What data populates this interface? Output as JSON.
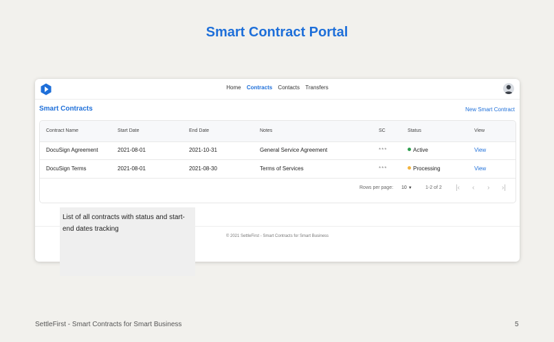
{
  "slide": {
    "title": "Smart Contract Portal",
    "footer_left": "SettleFirst - Smart Contracts for Smart Business",
    "page_number": "5"
  },
  "nav": {
    "items": [
      {
        "label": "Home",
        "active": false
      },
      {
        "label": "Contracts",
        "active": true
      },
      {
        "label": "Contacts",
        "active": false
      },
      {
        "label": "Transfers",
        "active": false
      }
    ]
  },
  "section": {
    "title": "Smart Contracts",
    "new_link": "New Smart Contract"
  },
  "table": {
    "headers": [
      "Contract Name",
      "Start Date",
      "End Date",
      "Notes",
      "SC",
      "Status",
      "View"
    ],
    "rows": [
      {
        "name": "DocuSign Agreement",
        "start": "2021-08-01",
        "end": "2021-10-31",
        "notes": "General Service Agreement",
        "sc": "***",
        "status": "Active",
        "status_color": "#2e9e4f",
        "view": "View"
      },
      {
        "name": "DocuSign Terms",
        "start": "2021-08-01",
        "end": "2021-08-30",
        "notes": "Terms of Services",
        "sc": "***",
        "status": "Processing",
        "status_color": "#f2b33d",
        "view": "View"
      }
    ],
    "pagination": {
      "rows_per_page_label": "Rows per page:",
      "rows_per_page_value": "10",
      "range": "1-2 of 2"
    }
  },
  "app_footer": "© 2021 SettleFirst - Smart Contracts for Smart Business",
  "callout": {
    "text": "List of all contracts with status and start-end dates tracking"
  },
  "colors": {
    "accent": "#1e6fd9",
    "background": "#f2f1ed"
  }
}
